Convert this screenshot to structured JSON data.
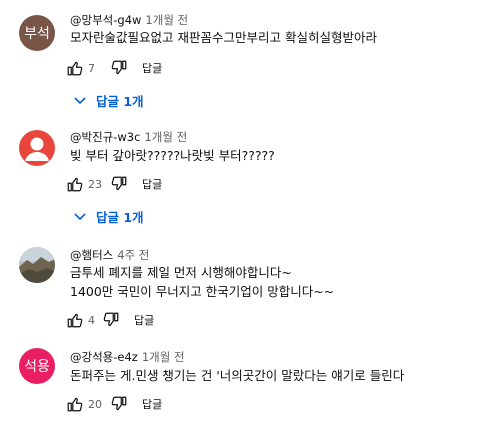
{
  "comments": [
    {
      "author": "@망부석-g4w",
      "time": "1개월 전",
      "avatar_text": "부석",
      "avatar_color": "#795548",
      "text": "모자란술값필요없고 재판꼼수그만부리고 확실히실형받아라",
      "likes": "7",
      "reply_label": "답글",
      "replies_label": "답글 1개"
    },
    {
      "author": "@박진규-w3c",
      "time": "1개월 전",
      "avatar_color": "#e8453c",
      "text": "빚 부터 갚아랏?????나랏빚 부터?????",
      "likes": "23",
      "reply_label": "답글",
      "replies_label": "답글 1개"
    },
    {
      "author": "@햄터스",
      "time": "4주 전",
      "text_lines": [
        "금투세 폐지를 제일 먼저 시행해야합니다~",
        "1400만 국민이 무너지고 한국기업이 망합니다~~"
      ],
      "likes": "4",
      "reply_label": "답글"
    },
    {
      "author": "@강석용-e4z",
      "time": "1개월 전",
      "avatar_text": "석용",
      "avatar_color": "#e91e63",
      "text": "돈퍼주는 게.민생 챙기는 건 '너의곳간이 말랐다는 얘기로 들린다",
      "likes": "20",
      "reply_label": "답글"
    }
  ]
}
